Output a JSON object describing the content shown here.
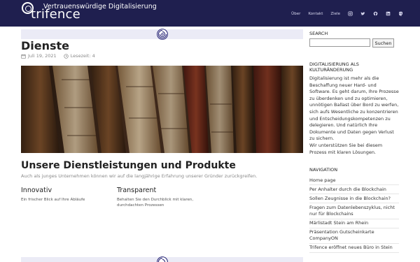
{
  "site": {
    "logo_text": "trifence",
    "tagline": "Vertrauenswürdige Digitalisierung"
  },
  "nav": {
    "links": [
      "Über",
      "Kontakt",
      "Ziele"
    ],
    "icons": [
      "instagram-icon",
      "twitter-icon",
      "github-icon",
      "linkedin-icon",
      "mastodon-icon"
    ]
  },
  "post": {
    "title": "Dienste",
    "date": "Juli 19, 2021",
    "reading_time": "Lesezeit: 4"
  },
  "section": {
    "title": "Unsere Dienstleistungen und Produkte",
    "subtitle": "Auch als junges Unternehmen können wir auf die langjährige Erfahrung unserer Gründer zurückgreifen."
  },
  "columns": [
    {
      "title": "Innovativ",
      "text": "Ein frischer Blick auf Ihre Abläufe"
    },
    {
      "title": "Transparent",
      "text": "Behalten Sie den Durchblick mit klaren, durchdachten Prozessen"
    }
  ],
  "sidebar": {
    "search_label": "SEARCH",
    "search_button": "Suchen",
    "search_value": "",
    "about_heading_1": "DIGITALISIERUNG ALS",
    "about_heading_2": "KULTURÄNDERUNG",
    "about_text": "Digitalisierung ist mehr als die Beschaffung neuer Hard- und Software. Es geht darum, Ihre Prozesse zu überdenken und zu optimieren, unnötigen Ballast über Bord zu werfen, sich aufs Wesentliche zu konzentrieren und Entscheidungskompetenzen zu delegieren. Und natürlich Ihre Dokumente und Daten gegen Verlust zu sichern.",
    "about_text_2": "Wir unterstützen Sie bei diesem Prozess mit klaren Lösungen.",
    "navigation_heading": "NAVIGATION",
    "navigation_items": [
      "Home page",
      "Per Anhalter durch die Blockchain",
      "Sollen Zeugnisse in die Blockchain?",
      "Fragen zum Datenlebenszyklus, nicht nur für Blockchains",
      "Märlistadt Stein am Rhein",
      "Präsentation Gutscheinkarte CompanyON",
      "Trifence eröffnet neues Büro in Stein"
    ]
  },
  "colors": {
    "header_bg": "#1f1f4f",
    "accent": "#2c2a7a",
    "strip_bg": "#ebebf6"
  }
}
